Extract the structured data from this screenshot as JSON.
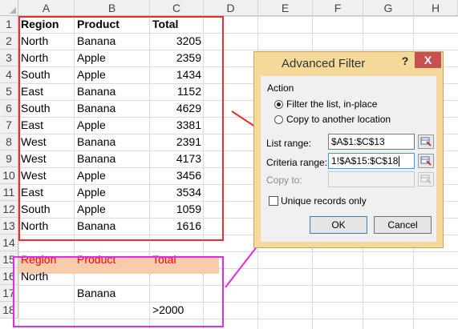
{
  "sheet": {
    "columns": [
      "A",
      "B",
      "C",
      "D",
      "E",
      "F",
      "G",
      "H"
    ],
    "rows": [
      "1",
      "2",
      "3",
      "4",
      "5",
      "6",
      "7",
      "8",
      "9",
      "10",
      "11",
      "12",
      "13",
      "14",
      "15",
      "16",
      "17",
      "18"
    ],
    "table_headers": [
      "Region",
      "Product",
      "Total"
    ],
    "table_rows": [
      [
        "North",
        "Banana",
        "3205"
      ],
      [
        "North",
        "Apple",
        "2359"
      ],
      [
        "South",
        "Apple",
        "1434"
      ],
      [
        "East",
        "Banana",
        "1152"
      ],
      [
        "South",
        "Banana",
        "4629"
      ],
      [
        "East",
        "Apple",
        "3381"
      ],
      [
        "West",
        "Banana",
        "2391"
      ],
      [
        "West",
        "Banana",
        "4173"
      ],
      [
        "West",
        "Apple",
        "3456"
      ],
      [
        "East",
        "Apple",
        "3534"
      ],
      [
        "South",
        "Apple",
        "1059"
      ],
      [
        "North",
        "Banana",
        "1616"
      ]
    ],
    "criteria_headers": [
      "Region",
      "Product",
      "Total"
    ],
    "criteria_rows": [
      [
        "North",
        "",
        ""
      ],
      [
        "",
        "Banana",
        ""
      ],
      [
        "",
        "",
        ">2000"
      ]
    ]
  },
  "dialog": {
    "title": "Advanced Filter",
    "help": "?",
    "close": "X",
    "action_label": "Action",
    "option_filter": "Filter the list, in-place",
    "option_copy": "Copy to another location",
    "list_range_label": "List range:",
    "list_range_value": "$A$1:$C$13",
    "criteria_range_label": "Criteria range:",
    "criteria_range_value": "1!$A$15:$C$18",
    "copy_to_label": "Copy to:",
    "copy_to_value": "",
    "unique_label": "Unique records only",
    "ok": "OK",
    "cancel": "Cancel"
  },
  "colors": {
    "data_box": "#ed2d2d",
    "criteria_box": "#e02ce8",
    "criteria_header_fill": "#f8cbad",
    "criteria_header_text": "#ff0000",
    "dialog_frame": "#f5d99a"
  }
}
